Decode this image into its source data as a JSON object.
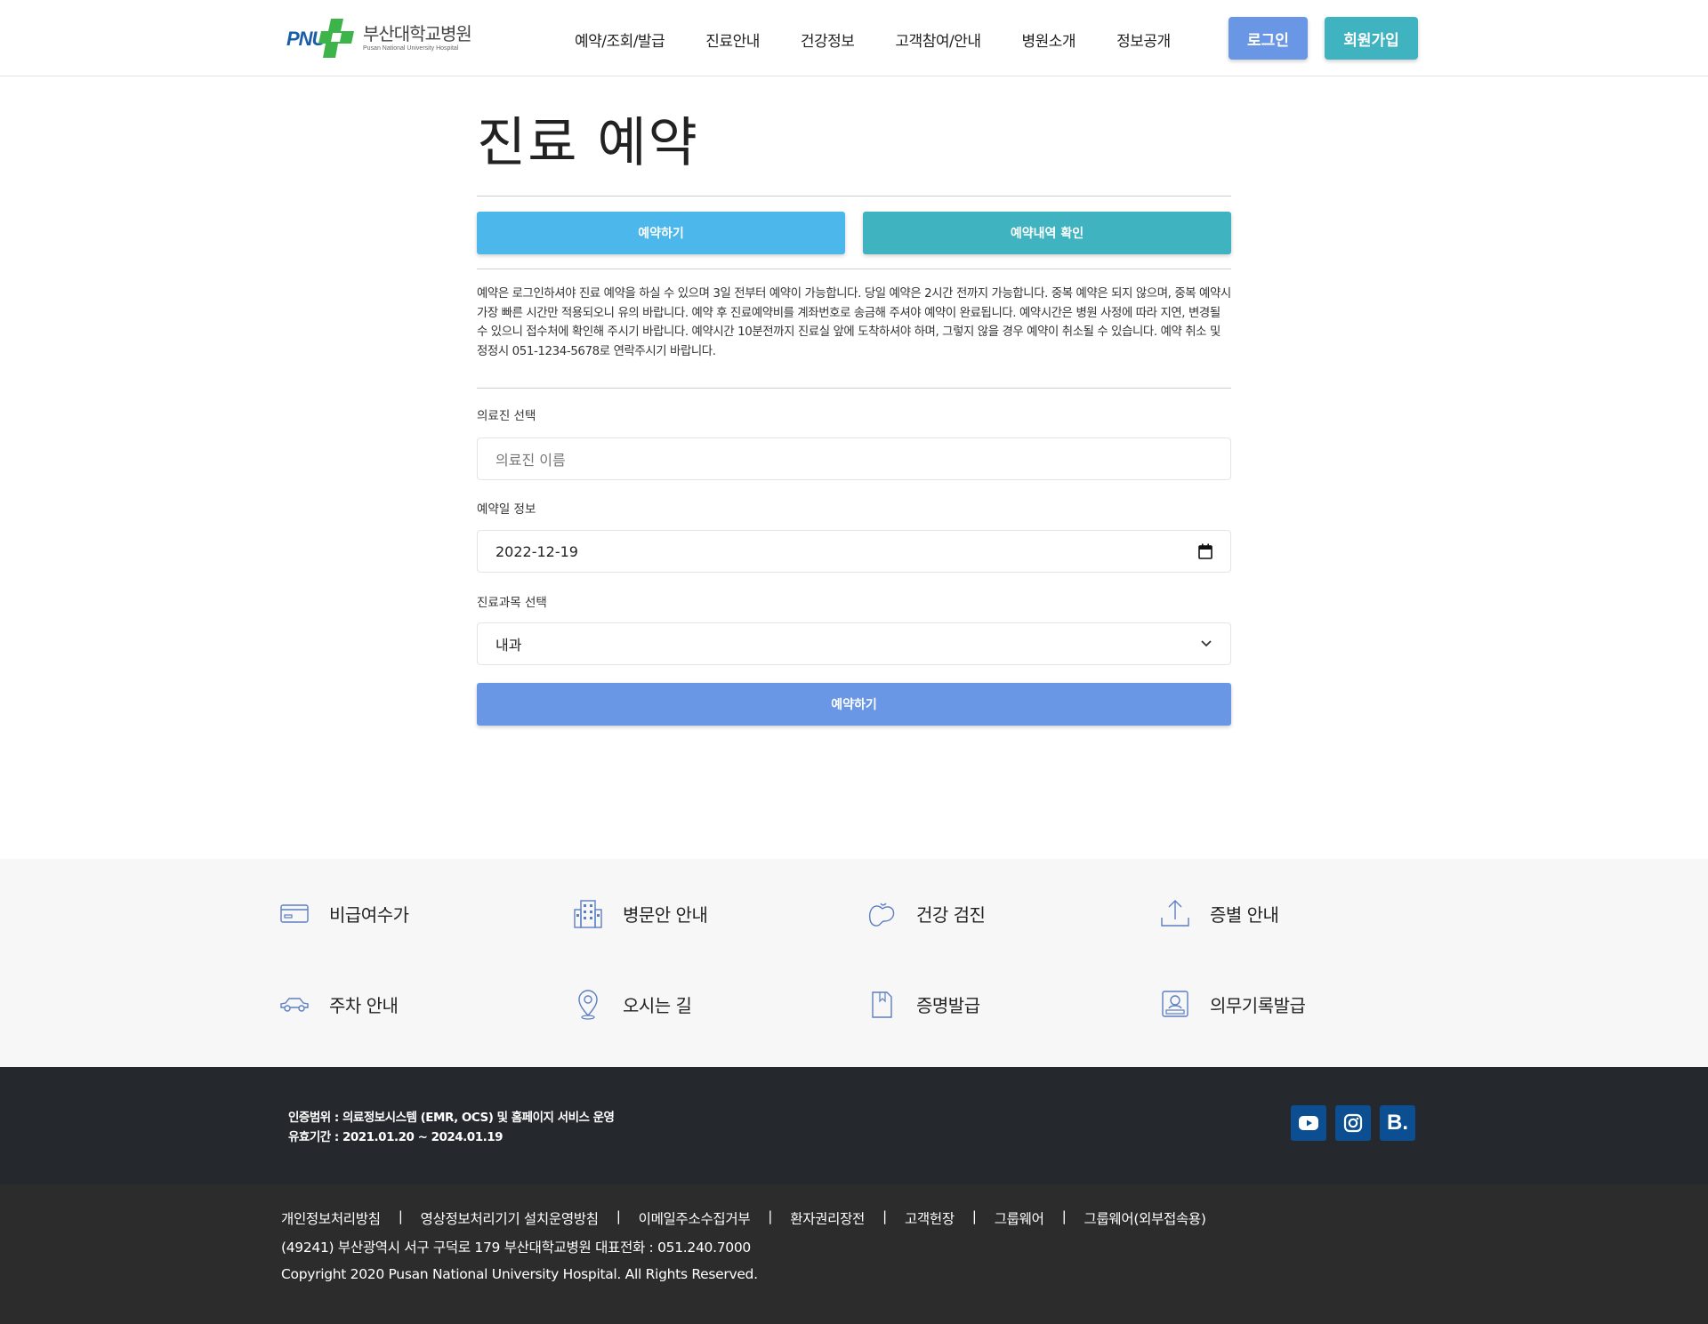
{
  "header": {
    "logo_mark_text": "PNU",
    "logo_korean": "부산대학교병원",
    "logo_english": "Pusan National University Hospital",
    "nav": [
      "예약/조회/발급",
      "진료안내",
      "건강정보",
      "고객참여/안내",
      "병원소개",
      "정보공개"
    ],
    "login_label": "로그인",
    "join_label": "회원가입",
    "colors": {
      "login": "#6a96e6",
      "join": "#3fb3bf",
      "logo_blue": "#1b5ea8",
      "logo_green": "#3cb44a"
    }
  },
  "main": {
    "title": "진료 예약",
    "tab_book_label": "예약하기",
    "tab_check_label": "예약내역 확인",
    "notice": "예약은 로그인하셔야 진료 예약을 하실 수 있으며 3일 전부터 예약이 가능합니다. 당일 예약은 2시간 전까지 가능합니다. 중복 예약은 되지 않으며, 중복 예약시 가장 빠른 시간만 적용되오니 유의 바랍니다. 예약 후 진료예약비를 계좌번호로 송금해 주셔야 예약이 완료됩니다. 예약시간은 병원 사정에 따라 지연, 변경될 수 있으니 접수처에 확인해 주시기 바랍니다. 예약시간 10분전까지 진료실 앞에 도착하셔야 하며, 그렇지 않을 경우 예약이 취소될 수 있습니다. 예약 취소 및 정정시 051-1234-5678로 연락주시기 바랍니다.",
    "doctor_label": "의료진 선택",
    "doctor_placeholder": "의료진 이름",
    "date_label": "예약일 정보",
    "date_value": "2022-12-19",
    "dept_label": "진료과목 선택",
    "dept_value": "내과",
    "submit_label": "예약하기"
  },
  "quick_links": [
    {
      "label": "비급여수가",
      "icon": "card-icon"
    },
    {
      "label": "병문안 안내",
      "icon": "hospital-building-icon"
    },
    {
      "label": "건강 검진",
      "icon": "organ-icon"
    },
    {
      "label": "증별 안내",
      "icon": "upload-icon"
    },
    {
      "label": "주차 안내",
      "icon": "car-icon"
    },
    {
      "label": "오시는 길",
      "icon": "map-pin-icon"
    },
    {
      "label": "증명발급",
      "icon": "document-icon"
    },
    {
      "label": "의무기록발급",
      "icon": "id-record-icon"
    }
  ],
  "footer": {
    "cert_scope": "인증범위 : 의료정보시스템 (EMR, OCS) 및 홈페이지 서비스 운영",
    "cert_period": "유효기간 : 2021.01.20 ~ 2024.01.19",
    "social": [
      "youtube-icon",
      "instagram-icon",
      "blog-icon"
    ],
    "blog_letter": "B.",
    "links": [
      "개인정보처리방침",
      "영상정보처리기기 설치운영방침",
      "이메일주소수집거부",
      "환자권리장전",
      "고객헌장",
      "그룹웨어",
      "그룹웨어(외부접속용)"
    ],
    "separator": "|",
    "address": "(49241) 부산광역시 서구 구덕로 179 부산대학교병원 대표전화 : 051.240.7000",
    "copyright": "Copyright 2020 Pusan National University Hospital. All Rights Reserved."
  }
}
